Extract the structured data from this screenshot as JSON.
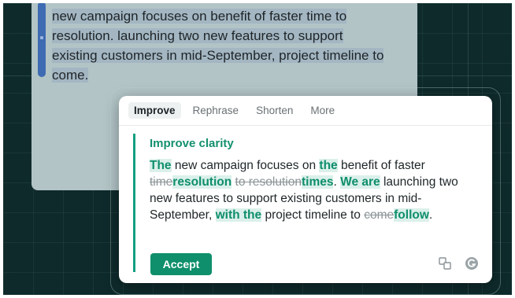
{
  "document": {
    "text": "new campaign focuses on benefit of faster time to resolution. launching two new features to support existing customers in mid-September, project timeline to come."
  },
  "assistant": {
    "tabs": [
      {
        "label": "Improve",
        "active": true
      },
      {
        "label": "Rephrase",
        "active": false
      },
      {
        "label": "Shorten",
        "active": false
      },
      {
        "label": "More",
        "active": false
      }
    ],
    "suggestion_title": "Improve clarity",
    "suggestion": {
      "s1": "The",
      "s2": " new campaign focuses on ",
      "s3": "the",
      "s4": " benefit of faster ",
      "s5": "time",
      "s6": "resolution",
      "s7": " ",
      "s8": "to resolution",
      "s9": "times",
      "s10": ". ",
      "s11": "We are",
      "s12": " launching two new features to support existing customers in mid-September, ",
      "s13": "with the",
      "s14": " project timeline to ",
      "s15": "come",
      "s16": "follow",
      "s17": "."
    },
    "accept_label": "Accept",
    "icons": [
      "copy-icon",
      "grammarly-icon"
    ]
  },
  "colors": {
    "accent": "#0f8f6b",
    "background": "#0f2a2b",
    "selection": "#a3b6c2"
  }
}
